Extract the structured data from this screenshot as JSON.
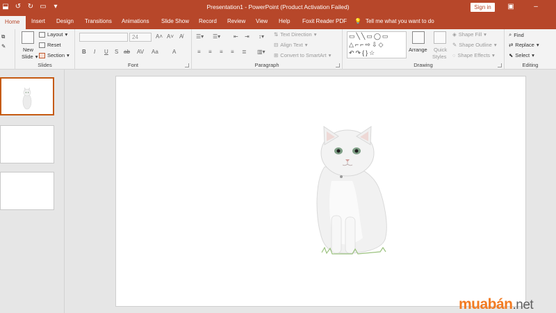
{
  "app": {
    "title": "Presentation1  -  PowerPoint (Product Activation Failed)",
    "sign_in": "Sign in",
    "accent": "#b7472a"
  },
  "quick_access": [
    "save-icon",
    "undo-icon",
    "redo-icon",
    "present-icon",
    "customize-icon"
  ],
  "tabs": [
    {
      "label": "Home",
      "active": true
    },
    {
      "label": "Insert"
    },
    {
      "label": "Design"
    },
    {
      "label": "Transitions"
    },
    {
      "label": "Animations"
    },
    {
      "label": "Slide Show"
    },
    {
      "label": "Record"
    },
    {
      "label": "Review"
    },
    {
      "label": "View"
    },
    {
      "label": "Help"
    },
    {
      "label": "Foxit Reader PDF"
    }
  ],
  "tell_me": "Tell me what you want to do",
  "ribbon": {
    "slides": {
      "label": "Slides",
      "new_slide": "New",
      "new_slide_2": "Slide",
      "layout": "Layout",
      "reset": "Reset",
      "section": "Section"
    },
    "font": {
      "label": "Font",
      "size": "24",
      "buttons": [
        "B",
        "I",
        "U",
        "S",
        "ab",
        "AV",
        "Aa",
        "A"
      ]
    },
    "paragraph": {
      "label": "Paragraph",
      "text_direction": "Text Direction",
      "align_text": "Align Text",
      "convert_smartart": "Convert to SmartArt"
    },
    "drawing": {
      "label": "Drawing",
      "shapes_row1": "▭╲╲▭◯▭",
      "shapes_row2": "△⌐⌐⇨⇩◇",
      "shapes_row3": "↶↷{}☆",
      "arrange": "Arrange",
      "quick_styles": "Quick",
      "quick_styles_2": "Styles",
      "shape_fill": "Shape Fill",
      "shape_outline": "Shape Outline",
      "shape_effects": "Shape Effects"
    },
    "editing": {
      "label": "Editing",
      "find": "Find",
      "replace": "Replace",
      "select": "Select"
    }
  },
  "thumbnails": [
    {
      "num": "1",
      "selected": true,
      "content": "cat-image"
    },
    {
      "num": "2"
    },
    {
      "num": "3"
    }
  ],
  "slide": {
    "content": "cat-image"
  },
  "watermark": {
    "main": "muabán",
    "suffix": ".net"
  }
}
